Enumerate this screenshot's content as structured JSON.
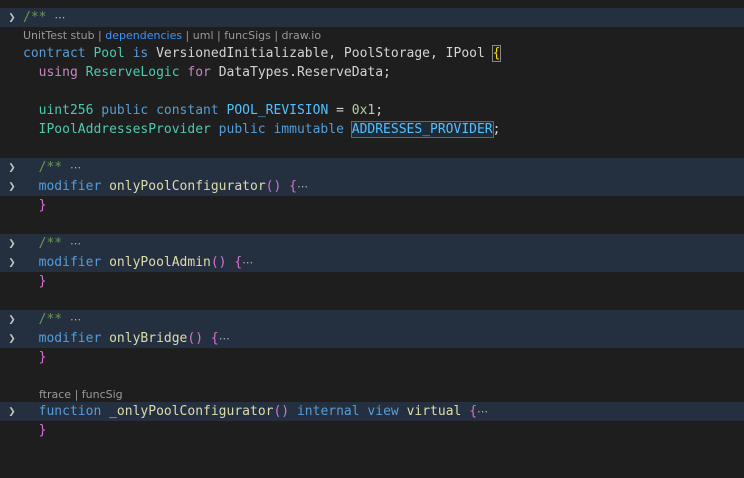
{
  "lenses": {
    "contract": [
      {
        "label": "UnitTest stub"
      },
      {
        "label": "dependencies",
        "hover": true
      },
      {
        "label": "uml"
      },
      {
        "label": "funcSigs"
      },
      {
        "label": "draw.io"
      }
    ],
    "separator": " | ",
    "function": [
      {
        "label": "ftrace"
      },
      {
        "label": "funcSig"
      }
    ]
  },
  "code": {
    "collapsed_comment": "/**",
    "ellipsis": "⋯",
    "contract_kw": "contract",
    "contract_name": "Pool",
    "is_kw": "is",
    "bases": "VersionedInitializable, PoolStorage, IPool",
    "open_brace": "{",
    "using_kw": "using",
    "using_lib": "ReserveLogic",
    "for_kw": "for",
    "using_type": "DataTypes.ReserveData;",
    "uint_kw": "uint256",
    "public_kw": "public",
    "constant_kw": "constant",
    "revision_name": "POOL_REVISION",
    "equals": " = ",
    "revision_value": "0x1",
    "semicolon": ";",
    "provider_type": "IPoolAddressesProvider",
    "immutable_kw": "immutable",
    "provider_name": "ADDRESSES_PROVIDER",
    "modifier_kw": "modifier",
    "parens": "()",
    "close_brace": "}",
    "mod1": "onlyPoolConfigurator",
    "mod2": "onlyPoolAdmin",
    "mod3": "onlyBridge",
    "function_kw": "function",
    "fn_name": "_onlyPoolConfigurator",
    "internal_kw": "internal",
    "view_kw": "view",
    "virtual_kw": "virtual"
  },
  "icons": {
    "fold": "chevron-right-icon",
    "fold_glyph": "❯"
  }
}
